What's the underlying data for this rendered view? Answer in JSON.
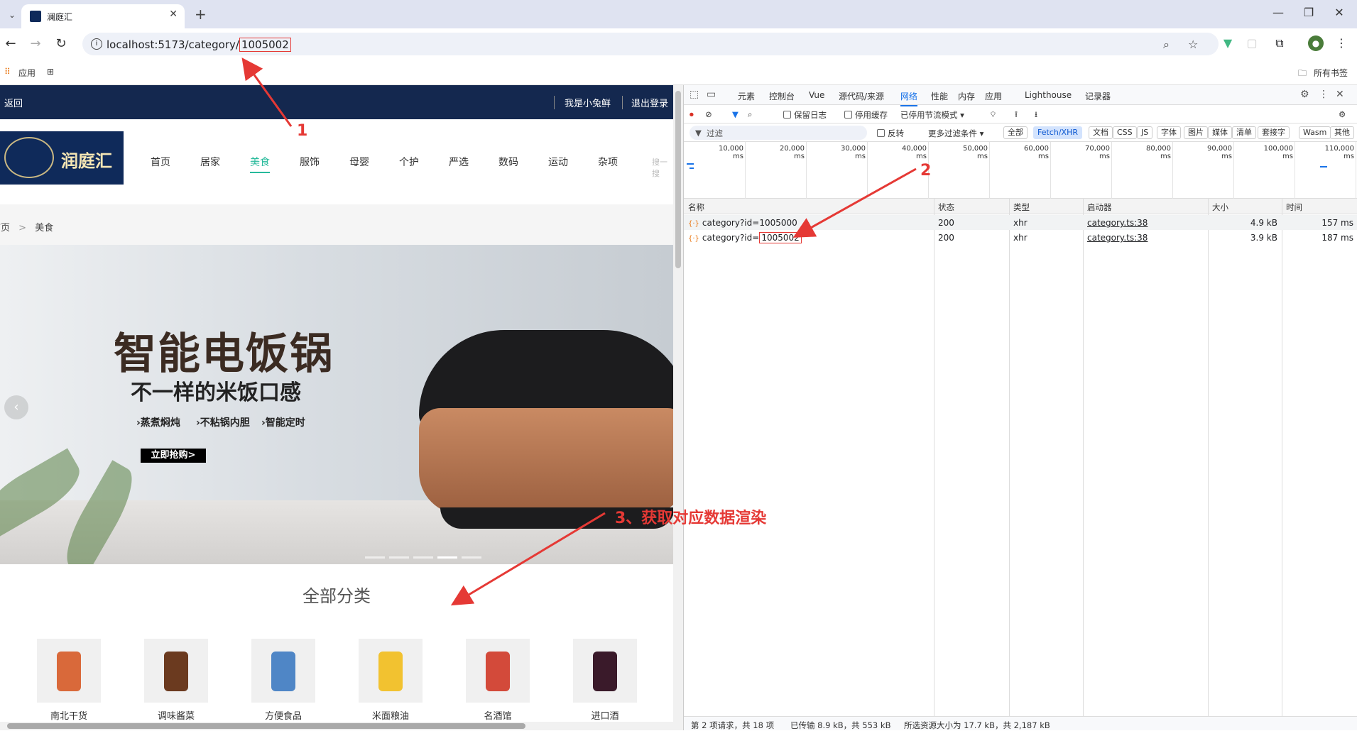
{
  "browser": {
    "tab_title": "澜庭汇",
    "url_prefix": "localhost:5173/category/",
    "url_id": "1005002",
    "bookmarks": {
      "apps": "应用",
      "all": "所有书签"
    }
  },
  "site": {
    "back": "返回",
    "user": "我是小兔鲜",
    "logout": "退出登录",
    "logo_text": "润庭汇",
    "nav": [
      "首页",
      "居家",
      "美食",
      "服饰",
      "母婴",
      "个护",
      "严选",
      "数码",
      "运动",
      "杂项"
    ],
    "active_nav": "美食",
    "search_hint": "搜一搜",
    "breadcrumb": {
      "home": "首页",
      "sep": ">",
      "current": "美食"
    },
    "banner": {
      "title": "智能电饭锅",
      "subtitle": "不一样的米饭口感",
      "features": [
        "›蒸煮焖炖",
        "›不粘锅内胆",
        "›智能定时"
      ],
      "button": "立即抢购>"
    },
    "all_categories_title": "全部分类",
    "categories": [
      {
        "label": "南北干货",
        "color": "#d9693a"
      },
      {
        "label": "调味酱菜",
        "color": "#6b3a1f"
      },
      {
        "label": "方便食品",
        "color": "#4f86c6"
      },
      {
        "label": "米面粮油",
        "color": "#f2c230"
      },
      {
        "label": "名酒馆",
        "color": "#d34a3a"
      },
      {
        "label": "进口酒",
        "color": "#3a1a2a"
      }
    ]
  },
  "devtools": {
    "tabs": [
      "元素",
      "控制台",
      "Vue",
      "源代码/来源",
      "网络",
      "性能",
      "内存",
      "应用",
      "Lighthouse",
      "记录器"
    ],
    "active_tab": "网络",
    "toolbar": {
      "preserve_log": "保留日志",
      "disable_cache": "停用缓存",
      "throttle": "已停用节流模式"
    },
    "filter": {
      "placeholder": "过滤",
      "invert": "反转",
      "more": "更多过滤条件 ▾"
    },
    "type_filters": [
      "全部",
      "Fetch/XHR",
      "文档",
      "CSS",
      "JS",
      "字体",
      "图片",
      "媒体",
      "清单",
      "套接字",
      "Wasm",
      "其他"
    ],
    "active_type": "Fetch/XHR",
    "timeline_ticks": [
      "10,000 ms",
      "20,000 ms",
      "30,000 ms",
      "40,000 ms",
      "50,000 ms",
      "60,000 ms",
      "70,000 ms",
      "80,000 ms",
      "90,000 ms",
      "100,000 ms",
      "110,000 ms"
    ],
    "columns": [
      "名称",
      "状态",
      "类型",
      "启动器",
      "大小",
      "时间"
    ],
    "rows": [
      {
        "name_prefix": "category?id=",
        "id": "1005000",
        "status": "200",
        "type": "xhr",
        "initiator": "category.ts:38",
        "size": "4.9 kB",
        "time": "157 ms"
      },
      {
        "name_prefix": "category?id=",
        "id": "1005002",
        "status": "200",
        "type": "xhr",
        "initiator": "category.ts:38",
        "size": "3.9 kB",
        "time": "187 ms"
      }
    ],
    "status_bar": [
      "第 2 项请求，共 18 项",
      "已传输 8.9 kB，共 553 kB",
      "所选资源大小为 17.7 kB，共 2,187 kB"
    ]
  },
  "annotations": {
    "n1": "1",
    "n2": "2",
    "n3": "3、获取对应数据渲染"
  },
  "colors": {
    "annotation": "#e53935",
    "site_header": "#14284f",
    "accent": "#27ba9b",
    "devtools_accent": "#1a73e8"
  }
}
